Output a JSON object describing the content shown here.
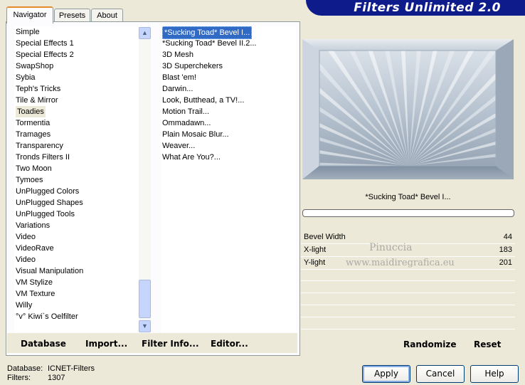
{
  "window": {
    "banner_title": "Filters Unlimited 2.0"
  },
  "tabs": [
    "Navigator",
    "Presets",
    "About"
  ],
  "categories": [
    "Simple",
    "Special Effects 1",
    "Special Effects 2",
    "SwapShop",
    "Sybia",
    "Teph's Tricks",
    "Tile & Mirror",
    "Toadies",
    "Tormentia",
    "Tramages",
    "Transparency",
    "Tronds Filters II",
    "Two Moon",
    "Tymoes",
    "UnPlugged Colors",
    "UnPlugged Shapes",
    "UnPlugged Tools",
    "Variations",
    "Video",
    "VideoRave",
    "Video",
    "Visual Manipulation",
    "VM Stylize",
    "VM Texture",
    "Willy",
    "°v° Kiwi`s Oelfilter"
  ],
  "selected_category": "Toadies",
  "filters": [
    "*Sucking Toad*  Bevel I...",
    "*Sucking Toad*  Bevel II.2...",
    "3D Mesh",
    "3D Superchekers",
    "Blast 'em!",
    "Darwin...",
    "Look, Butthead, a TV!...",
    "Motion Trail...",
    "Ommadawn...",
    "Plain Mosaic Blur...",
    "Weaver...",
    "What Are You?..."
  ],
  "selected_filter": "*Sucking Toad*  Bevel I...",
  "toolbar": {
    "database": "Database",
    "import": "Import...",
    "filter_info": "Filter Info...",
    "editor": "Editor..."
  },
  "preview": {
    "filter_name": "*Sucking Toad*  Bevel I...",
    "progress": 0
  },
  "params": [
    {
      "label": "Bevel Width",
      "value": "44"
    },
    {
      "label": "X-light",
      "value": "183"
    },
    {
      "label": "Y-light",
      "value": "201"
    }
  ],
  "watermark": {
    "line1": "Pinuccia",
    "line2": "www.maidiregrafica.eu"
  },
  "right_toolbar": {
    "randomize": "Randomize",
    "reset": "Reset"
  },
  "status": {
    "database_label": "Database:",
    "database_value": "ICNET-Filters",
    "filters_label": "Filters:",
    "filters_value": "1307"
  },
  "buttons": {
    "apply": "Apply",
    "cancel": "Cancel",
    "help": "Help"
  },
  "colors": {
    "accent": "#316ac5",
    "banner": "#0e1b8a",
    "tab_active": "#e68b2c"
  }
}
